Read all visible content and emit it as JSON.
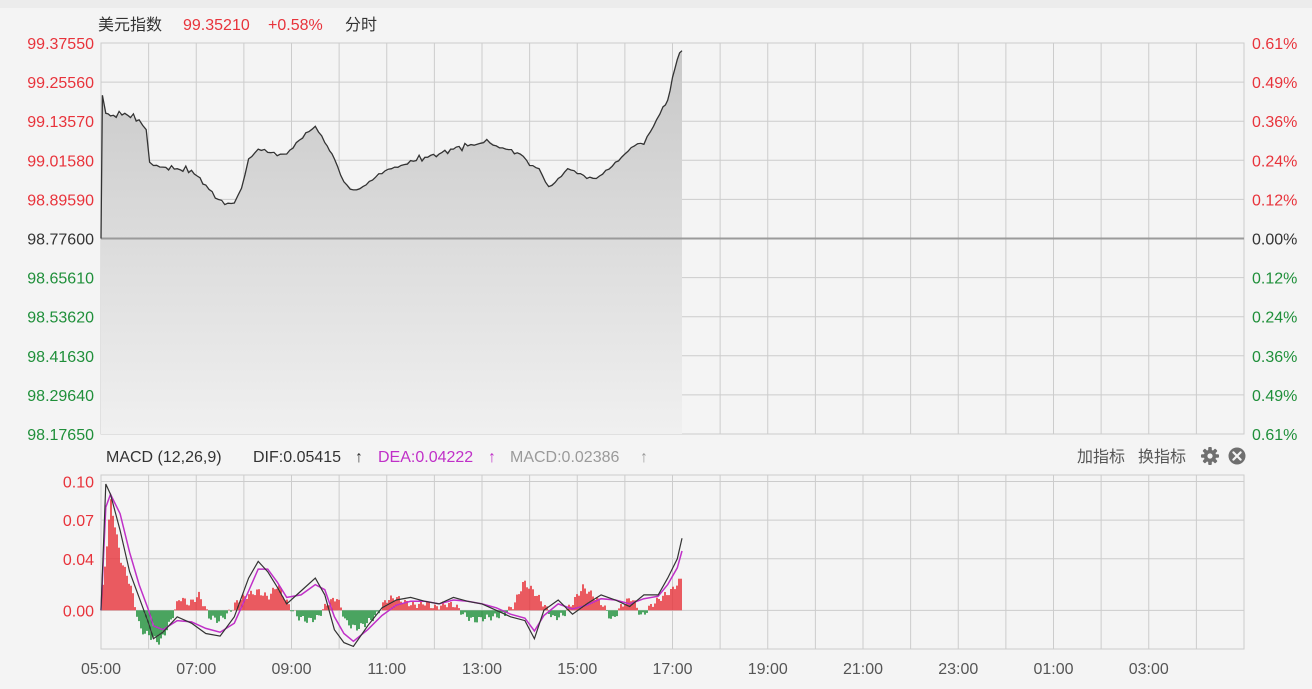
{
  "header": {
    "title": "美元指数",
    "price": "99.35210",
    "change": "+0.58%",
    "mode": "分时"
  },
  "macd_header": {
    "label": "MACD (12,26,9)",
    "dif": "DIF:0.05415",
    "dea": "DEA:0.04222",
    "macd": "MACD:0.02386",
    "arrow": "↑",
    "add_indicator": "加指标",
    "switch_indicator": "换指标"
  },
  "icons": {
    "settings": "gear-icon",
    "close": "close-icon"
  },
  "colors": {
    "up": "#e8333b",
    "down": "#1f8f3a",
    "price_line": "#333333",
    "dea_line": "#c030c8",
    "dif_line": "#333333",
    "grid": "#cccccc",
    "neutral": "#333333"
  },
  "chart_data": [
    {
      "type": "area",
      "baseline": 98.776,
      "ylim": [
        98.1765,
        99.3755
      ],
      "y_ticks": [
        "99.37550",
        "99.25560",
        "99.13570",
        "99.01580",
        "98.89590",
        "98.77600",
        "98.65610",
        "98.53620",
        "98.41630",
        "98.29640",
        "98.17650"
      ],
      "pct_ticks": [
        "0.61%",
        "0.49%",
        "0.36%",
        "0.24%",
        "0.12%",
        "0.00%",
        "0.12%",
        "0.24%",
        "0.36%",
        "0.49%",
        "0.61%"
      ],
      "x_ticks": [
        "05:00",
        "07:00",
        "09:00",
        "11:00",
        "13:00",
        "15:00",
        "17:00",
        "19:00",
        "21:00",
        "23:00",
        "01:00",
        "03:00"
      ],
      "x_range_hours": [
        5,
        29
      ],
      "series": [
        {
          "x": [
            5.0,
            5.03,
            5.1,
            5.2,
            5.5,
            5.8,
            5.95,
            6.02,
            6.1,
            6.3,
            6.6,
            6.9,
            7.2,
            7.4,
            7.6,
            7.8,
            7.95,
            8.1,
            8.3,
            8.5,
            8.7,
            8.9,
            9.1,
            9.3,
            9.5,
            9.7,
            9.8,
            9.9,
            10.1,
            10.3,
            10.5,
            10.7,
            10.9,
            11.1,
            11.3,
            11.5,
            11.8,
            12.1,
            12.4,
            12.7,
            12.9,
            13.1,
            13.3,
            13.5,
            13.8,
            14.0,
            14.2,
            14.4,
            14.6,
            14.8,
            15.0,
            15.2,
            15.4,
            15.6,
            15.8,
            16.0,
            16.2,
            16.4,
            16.6,
            16.8,
            16.9,
            17.0,
            17.1,
            17.15,
            17.2
          ],
          "y": [
            98.776,
            99.215,
            99.16,
            99.152,
            99.16,
            99.14,
            99.11,
            99.01,
            99.0,
            98.995,
            98.99,
            98.985,
            98.94,
            98.9,
            98.88,
            98.885,
            98.93,
            99.02,
            99.05,
            99.04,
            99.03,
            99.035,
            99.07,
            99.1,
            99.12,
            99.07,
            99.045,
            99.02,
            98.95,
            98.925,
            98.935,
            98.955,
            98.975,
            98.99,
            99.0,
            99.015,
            99.025,
            99.035,
            99.05,
            99.06,
            99.065,
            99.08,
            99.06,
            99.05,
            99.035,
            99.0,
            98.99,
            98.935,
            98.96,
            98.99,
            98.975,
            98.96,
            98.96,
            98.985,
            99.01,
            99.035,
            99.06,
            99.065,
            99.12,
            99.18,
            99.2,
            99.27,
            99.325,
            99.345,
            99.352
          ]
        }
      ]
    },
    {
      "type": "line",
      "title": "MACD (12,26,9)",
      "ylim": [
        -0.03,
        0.105
      ],
      "y_ticks": [
        "0.10",
        "0.07",
        "0.04",
        "0.00"
      ],
      "x_range_hours": [
        5,
        29
      ],
      "series": [
        {
          "name": "DIF",
          "x": [
            5.0,
            5.1,
            5.2,
            5.4,
            5.6,
            5.8,
            6.0,
            6.1,
            6.3,
            6.6,
            6.9,
            7.2,
            7.5,
            7.8,
            8.1,
            8.3,
            8.5,
            8.7,
            8.9,
            9.2,
            9.5,
            9.7,
            9.9,
            10.1,
            10.3,
            10.6,
            10.9,
            11.2,
            11.5,
            11.8,
            12.1,
            12.4,
            12.7,
            13.0,
            13.3,
            13.6,
            13.9,
            14.1,
            14.3,
            14.6,
            14.9,
            15.2,
            15.5,
            15.8,
            16.1,
            16.4,
            16.7,
            16.9,
            17.1,
            17.2
          ],
          "y": [
            0.0,
            0.098,
            0.09,
            0.062,
            0.03,
            0.01,
            -0.01,
            -0.022,
            -0.017,
            -0.005,
            -0.01,
            -0.018,
            -0.02,
            -0.005,
            0.025,
            0.038,
            0.03,
            0.018,
            0.005,
            0.015,
            0.025,
            0.012,
            -0.015,
            -0.025,
            -0.028,
            -0.012,
            0.002,
            0.008,
            0.01,
            0.007,
            0.005,
            0.01,
            0.007,
            0.005,
            0.0,
            -0.005,
            -0.008,
            -0.022,
            0.0,
            0.008,
            -0.003,
            0.005,
            0.012,
            0.008,
            0.003,
            0.012,
            0.012,
            0.025,
            0.04,
            0.056
          ]
        },
        {
          "name": "DEA",
          "x": [
            5.0,
            5.1,
            5.2,
            5.4,
            5.6,
            5.8,
            6.0,
            6.1,
            6.3,
            6.6,
            6.9,
            7.2,
            7.5,
            7.8,
            8.1,
            8.3,
            8.5,
            8.7,
            8.9,
            9.2,
            9.5,
            9.7,
            9.9,
            10.1,
            10.3,
            10.6,
            10.9,
            11.2,
            11.5,
            11.8,
            12.1,
            12.4,
            12.7,
            13.0,
            13.3,
            13.6,
            13.9,
            14.1,
            14.3,
            14.6,
            14.9,
            15.2,
            15.5,
            15.8,
            16.1,
            16.4,
            16.7,
            16.9,
            17.1,
            17.2
          ],
          "y": [
            0.0,
            0.08,
            0.09,
            0.075,
            0.045,
            0.02,
            0.0,
            -0.012,
            -0.015,
            -0.008,
            -0.009,
            -0.014,
            -0.017,
            -0.01,
            0.015,
            0.032,
            0.032,
            0.022,
            0.01,
            0.012,
            0.02,
            0.016,
            -0.005,
            -0.018,
            -0.024,
            -0.015,
            -0.004,
            0.004,
            0.007,
            0.007,
            0.005,
            0.008,
            0.007,
            0.005,
            0.002,
            -0.003,
            -0.006,
            -0.016,
            -0.004,
            0.005,
            0.001,
            0.004,
            0.009,
            0.008,
            0.005,
            0.009,
            0.011,
            0.02,
            0.033,
            0.046
          ]
        }
      ],
      "histogram": [
        0.0,
        0.085,
        0.04,
        0.02,
        -0.015,
        -0.02,
        -0.025,
        -0.01,
        0.01,
        0.005,
        0.012,
        -0.005,
        -0.008,
        -0.002,
        0.008,
        0.012,
        0.015,
        0.01,
        0.02,
        0.005,
        -0.005,
        -0.008,
        -0.006,
        0.005,
        0.01,
        -0.01,
        -0.014,
        -0.01,
        -0.004,
        0.008,
        0.01,
        0.006,
        0.004,
        0.006,
        0.002,
        0.005,
        0.004,
        -0.004,
        -0.008,
        -0.006,
        -0.005,
        -0.003,
        0.004,
        0.022,
        0.015,
        0.005,
        -0.006,
        -0.004,
        0.006,
        0.018,
        0.012,
        0.005,
        -0.008,
        0.004,
        0.01,
        -0.005,
        0.004,
        0.01,
        0.015,
        0.024
      ]
    }
  ]
}
